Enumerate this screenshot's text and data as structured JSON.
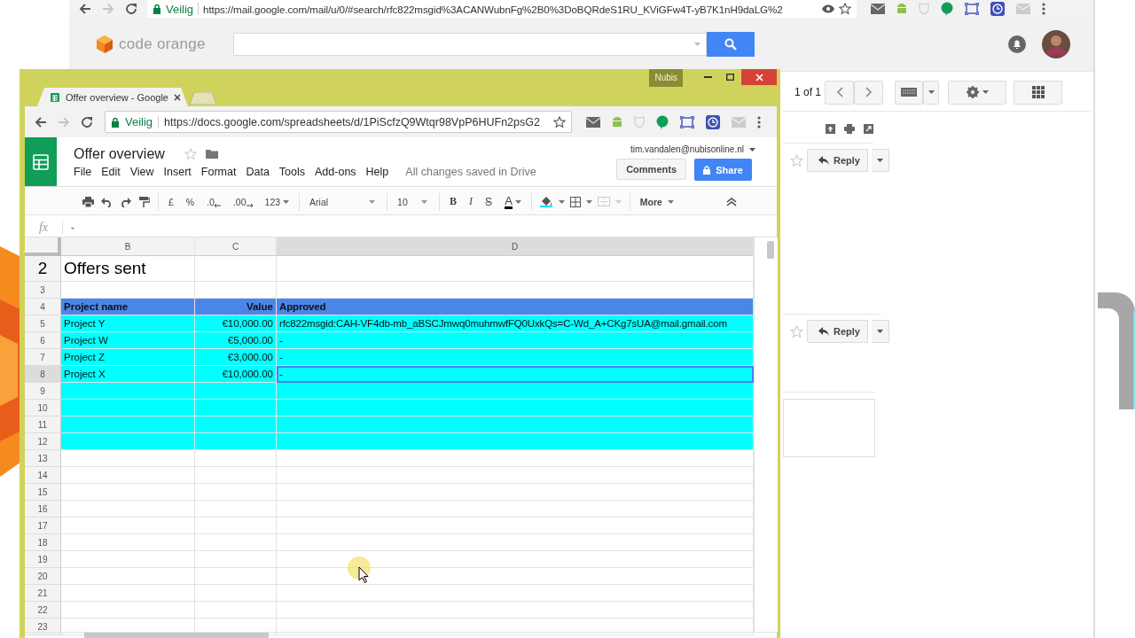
{
  "desktop": {
    "back_window": {
      "security_label": "Veilig",
      "url": "https://mail.google.com/mail/u/0/#search/rfc822msgid%3ACANWubnFg%2B0%3DoBQRdeS1RU_KViGFw4T-yB7K1nH9daLG%2",
      "brand": "code orange",
      "pager": "1 of 1",
      "reply_buttons": [
        "Reply",
        "Reply"
      ]
    },
    "front_window": {
      "profile_badge": "Nubis",
      "tab_title": "Offer overview - Google",
      "security_label": "Veilig",
      "url": "https://docs.google.com/spreadsheets/d/1PiScfzQ9Wtqr98VpP6HUFn2psG2",
      "doc_title": "Offer overview",
      "account": "tim.vandalen@nubisonline.nl",
      "menu": [
        "File",
        "Edit",
        "View",
        "Insert",
        "Format",
        "Data",
        "Tools",
        "Add-ons",
        "Help"
      ],
      "save_status": "All changes saved in Drive",
      "comments_button": "Comments",
      "share_button": "Share",
      "toolbar": {
        "currency": "£",
        "percent": "%",
        "decrease_decimals": ".0",
        "increase_decimals": ".00",
        "number_format": "123",
        "font": "Arial",
        "font_size": "10",
        "bold": "B",
        "italic": "I",
        "strikethrough": "S",
        "text_color": "A",
        "more": "More"
      },
      "formula_bar": {
        "label": "fx",
        "value": "-"
      },
      "columns": [
        "B",
        "C",
        "D"
      ],
      "rows": [
        {
          "number": "2",
          "kind": "title",
          "cells": [
            {
              "text": "Offers sent",
              "selected": false
            }
          ]
        },
        {
          "number": "3",
          "kind": "blank"
        },
        {
          "number": "4",
          "kind": "header",
          "cells": [
            {
              "text": "Project name",
              "selected": false
            },
            {
              "text": "Value",
              "selected": false
            },
            {
              "text": "Approved",
              "selected": false
            }
          ]
        },
        {
          "number": "5",
          "kind": "data",
          "cells": [
            {
              "text": "Project Y",
              "selected": false
            },
            {
              "text": "€10,000.00",
              "selected": false
            },
            {
              "text": "rfc822msgid:CAH-VF4db-mb_aBSCJmwq0muhmwfFQ0UxkQs=C-Wd_A+CKg7sUA@mail.gmail.com",
              "selected": false
            }
          ]
        },
        {
          "number": "6",
          "kind": "data",
          "cells": [
            {
              "text": "Project W",
              "selected": false
            },
            {
              "text": "€5,000.00",
              "selected": false
            },
            {
              "text": "-",
              "selected": false
            }
          ]
        },
        {
          "number": "7",
          "kind": "data",
          "cells": [
            {
              "text": "Project Z",
              "selected": false
            },
            {
              "text": "€3,000.00",
              "selected": false
            },
            {
              "text": "-",
              "selected": false
            }
          ]
        },
        {
          "number": "8",
          "kind": "data",
          "cells": [
            {
              "text": "Project X",
              "selected": false
            },
            {
              "text": "€10,000.00",
              "selected": false
            },
            {
              "text": "-",
              "selected": true
            }
          ]
        },
        {
          "number": "9",
          "kind": "filled"
        },
        {
          "number": "10",
          "kind": "filled"
        },
        {
          "number": "11",
          "kind": "filled"
        },
        {
          "number": "12",
          "kind": "filled"
        },
        {
          "number": "13",
          "kind": "blank"
        },
        {
          "number": "14",
          "kind": "blank"
        },
        {
          "number": "15",
          "kind": "blank"
        },
        {
          "number": "16",
          "kind": "blank"
        },
        {
          "number": "17",
          "kind": "blank"
        },
        {
          "number": "18",
          "kind": "blank"
        },
        {
          "number": "19",
          "kind": "blank"
        },
        {
          "number": "20",
          "kind": "blank"
        },
        {
          "number": "21",
          "kind": "blank"
        },
        {
          "number": "22",
          "kind": "blank"
        },
        {
          "number": "23",
          "kind": "blank"
        }
      ]
    }
  }
}
